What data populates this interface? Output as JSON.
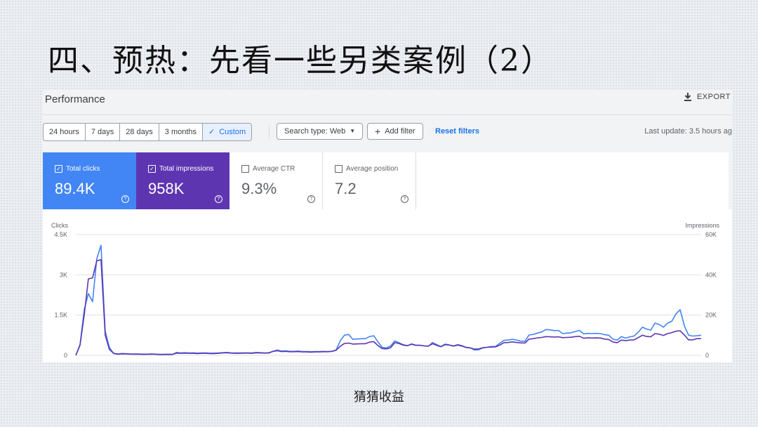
{
  "slide": {
    "title": "四、预热：先看一些另类案例（2）",
    "caption": "猜猜收益"
  },
  "panel": {
    "title": "Performance",
    "export_label": "EXPORT",
    "export_icon": "download-icon",
    "date_ranges": [
      "24 hours",
      "7 days",
      "28 days",
      "3 months",
      "Custom"
    ],
    "active_range": "Custom",
    "search_type": "Search type: Web",
    "add_filter": "Add filter",
    "reset_filters": "Reset filters",
    "last_update": "Last update: 3.5 hours ag"
  },
  "metrics": [
    {
      "label": "Total clicks",
      "value": "89.4K",
      "checked": true,
      "color": "#4285f4"
    },
    {
      "label": "Total impressions",
      "value": "958K",
      "checked": true,
      "color": "#5e35b1"
    },
    {
      "label": "Average CTR",
      "value": "9.3%",
      "checked": false
    },
    {
      "label": "Average position",
      "value": "7.2",
      "checked": false
    }
  ],
  "chart_data": {
    "type": "line",
    "left_axis": {
      "label": "Clicks",
      "ticks": [
        "4.5K",
        "3K",
        "1.5K",
        "0"
      ],
      "range": [
        0,
        4500
      ]
    },
    "right_axis": {
      "label": "Impressions",
      "ticks": [
        "60K",
        "40K",
        "20K",
        "0"
      ],
      "range": [
        0,
        60000
      ]
    },
    "grid": true,
    "series": [
      {
        "name": "Total clicks",
        "color": "#4285f4",
        "axis": "left",
        "values": [
          0,
          400,
          1700,
          2300,
          2000,
          3600,
          4100,
          900,
          300,
          70,
          40,
          55,
          50,
          45,
          40,
          45,
          35,
          40,
          45,
          40,
          30,
          30,
          35,
          30,
          110,
          90,
          100,
          90,
          95,
          85,
          90,
          90,
          80,
          85,
          90,
          100,
          110,
          95,
          90,
          90,
          95,
          95,
          90,
          110,
          100,
          90,
          100,
          150,
          200,
          160,
          170,
          150,
          150,
          160,
          140,
          145,
          135,
          145,
          140,
          150,
          145,
          150,
          200,
          540,
          750,
          780,
          600,
          610,
          620,
          620,
          700,
          730,
          500,
          300,
          280,
          350,
          540,
          470,
          400,
          360,
          430,
          380,
          380,
          350,
          340,
          480,
          400,
          330,
          420,
          390,
          350,
          400,
          360,
          300,
          280,
          200,
          210,
          280,
          300,
          330,
          330,
          450,
          560,
          570,
          600,
          570,
          530,
          520,
          760,
          780,
          830,
          870,
          960,
          950,
          920,
          930,
          810,
          830,
          840,
          890,
          930,
          800,
          820,
          810,
          820,
          810,
          770,
          750,
          600,
          570,
          700,
          640,
          690,
          720,
          860,
          1050,
          980,
          940,
          1200,
          1150,
          1050,
          1200,
          1270,
          1550,
          1700,
          1100,
          750,
          720,
          730,
          750
        ]
      },
      {
        "name": "Total impressions",
        "color": "#5e35b1",
        "axis": "right",
        "values": [
          0,
          5000,
          20000,
          38000,
          38500,
          47000,
          47500,
          10000,
          3000,
          1000,
          700,
          900,
          800,
          700,
          700,
          700,
          600,
          600,
          650,
          600,
          500,
          500,
          550,
          500,
          1100,
          1000,
          1100,
          1000,
          1000,
          900,
          1000,
          1000,
          900,
          900,
          1000,
          1200,
          1300,
          1100,
          1000,
          1000,
          1100,
          1100,
          1000,
          1300,
          1200,
          1100,
          1200,
          2000,
          2300,
          1900,
          2000,
          1800,
          1800,
          1900,
          1700,
          1700,
          1600,
          1700,
          1700,
          1800,
          1800,
          2000,
          2500,
          4500,
          5900,
          6100,
          5600,
          5700,
          5800,
          5800,
          6600,
          6800,
          4800,
          3400,
          3200,
          3800,
          6300,
          5900,
          5100,
          4800,
          5500,
          5000,
          5000,
          4700,
          4600,
          5800,
          5000,
          4300,
          5300,
          5100,
          4600,
          5100,
          4600,
          3900,
          3700,
          3100,
          3200,
          3800,
          4000,
          4100,
          4200,
          5100,
          6300,
          6400,
          6700,
          6400,
          6200,
          6100,
          8100,
          8300,
          8700,
          8900,
          9300,
          9200,
          9100,
          9200,
          8800,
          8900,
          9000,
          9300,
          9500,
          8500,
          8700,
          8600,
          8700,
          8600,
          8100,
          7800,
          6600,
          6300,
          7600,
          7300,
          7600,
          7700,
          8800,
          10000,
          9400,
          9200,
          10800,
          10500,
          9900,
          10800,
          11300,
          12000,
          12200,
          10100,
          7700,
          7700,
          8300,
          8300
        ]
      }
    ]
  }
}
